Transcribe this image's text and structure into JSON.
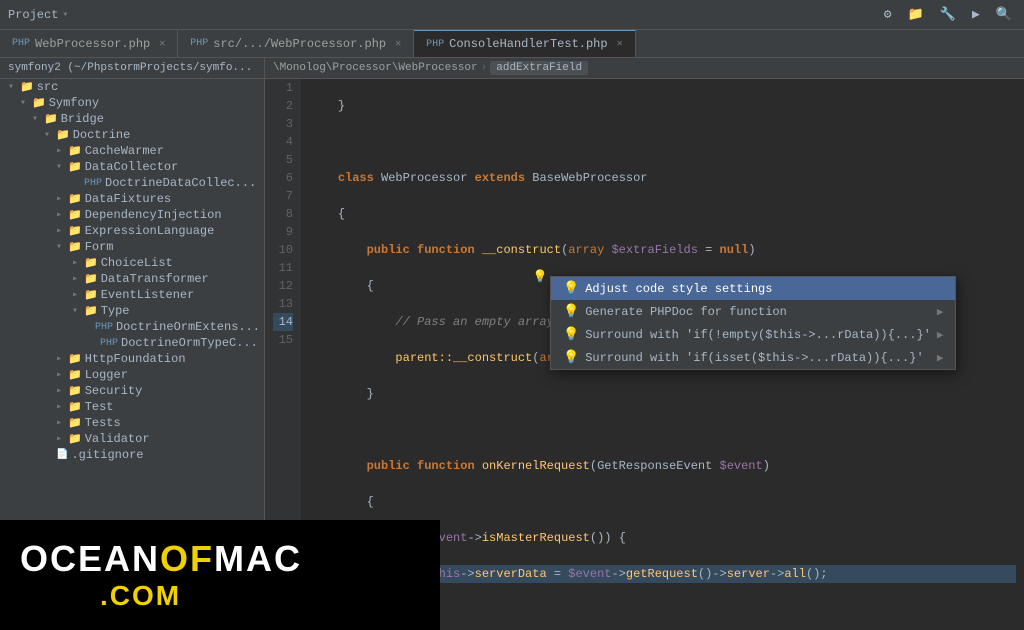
{
  "topbar": {
    "project_label": "Project",
    "icons": [
      "⚙",
      "📁",
      "🔧",
      "▶"
    ]
  },
  "tabs": [
    {
      "label": "WebProcessor.php",
      "active": false,
      "closable": true
    },
    {
      "label": "src/.../WebProcessor.php",
      "active": false,
      "closable": true
    },
    {
      "label": "ConsoleHandlerTest.php",
      "active": true,
      "closable": true
    }
  ],
  "breadcrumb": {
    "path": [
      "\\Monolog\\Processor\\WebProcessor"
    ],
    "active": "addExtraField"
  },
  "sidebar": {
    "header": "symfony2 (~/PhpstormProjects/symfo...",
    "items": [
      {
        "label": "src",
        "type": "folder",
        "level": 0,
        "expanded": true
      },
      {
        "label": "Symfony",
        "type": "folder",
        "level": 1,
        "expanded": true
      },
      {
        "label": "Bridge",
        "type": "folder",
        "level": 2,
        "expanded": true
      },
      {
        "label": "Doctrine",
        "type": "folder",
        "level": 3,
        "expanded": true
      },
      {
        "label": "CacheWarmer",
        "type": "folder",
        "level": 4,
        "expanded": false
      },
      {
        "label": "DataCollector",
        "type": "folder",
        "level": 4,
        "expanded": true
      },
      {
        "label": "DoctrineDataCollec...",
        "type": "file",
        "level": 5
      },
      {
        "label": "DataFixtures",
        "type": "folder",
        "level": 4,
        "expanded": false
      },
      {
        "label": "DependencyInjection",
        "type": "folder",
        "level": 4,
        "expanded": false
      },
      {
        "label": "ExpressionLanguage",
        "type": "folder",
        "level": 4,
        "expanded": false
      },
      {
        "label": "Form",
        "type": "folder",
        "level": 4,
        "expanded": true
      },
      {
        "label": "ChoiceList",
        "type": "folder",
        "level": 5,
        "expanded": false
      },
      {
        "label": "DataTransformer",
        "type": "folder",
        "level": 5,
        "expanded": false
      },
      {
        "label": "EventListener",
        "type": "folder",
        "level": 5,
        "expanded": false
      },
      {
        "label": "Type",
        "type": "folder",
        "level": 5,
        "expanded": true
      },
      {
        "label": "DoctrineOrmExtens...",
        "type": "file",
        "level": 6
      },
      {
        "label": "DoctrineOrmTypeC...",
        "type": "file",
        "level": 6
      },
      {
        "label": "HttpFoundation",
        "type": "folder",
        "level": 4,
        "expanded": false
      },
      {
        "label": "Logger",
        "type": "folder",
        "level": 4,
        "expanded": false
      },
      {
        "label": "Security",
        "type": "folder",
        "level": 4,
        "expanded": false
      },
      {
        "label": "Test",
        "type": "folder",
        "level": 4,
        "expanded": false
      },
      {
        "label": "Tests",
        "type": "folder",
        "level": 4,
        "expanded": false
      },
      {
        "label": "Validator",
        "type": "folder",
        "level": 4,
        "expanded": false
      },
      {
        "label": ".gitignore",
        "type": "file",
        "level": 3
      }
    ]
  },
  "code": {
    "lines": [
      {
        "num": 1,
        "text": "    }"
      },
      {
        "num": 2,
        "text": ""
      },
      {
        "num": 3,
        "text": "    class WebProcessor extends BaseWebProcessor"
      },
      {
        "num": 4,
        "text": "    {"
      },
      {
        "num": 5,
        "text": "        public function __construct(array $extraFields = null)"
      },
      {
        "num": 6,
        "text": "        {"
      },
      {
        "num": 7,
        "text": "            // Pass an empty array as the default null value would access $_SERVER"
      },
      {
        "num": 8,
        "text": "            parent::__construct(array(), $extraFields);"
      },
      {
        "num": 9,
        "text": "        }"
      },
      {
        "num": 10,
        "text": ""
      },
      {
        "num": 11,
        "text": "        public function onKernelRequest(GetResponseEvent $event)"
      },
      {
        "num": 12,
        "text": "        {"
      },
      {
        "num": 13,
        "text": "            if ($event->isMasterRequest()) {"
      },
      {
        "num": 14,
        "text": "                $this->serverData = $event->getRequest()->server->all();"
      },
      {
        "num": 15,
        "text": ""
      }
    ]
  },
  "context_menu": {
    "items": [
      {
        "label": "Adjust code style settings",
        "icon": "💡",
        "selected": true,
        "has_arrow": false
      },
      {
        "label": "Generate PHPDoc for function",
        "icon": "💡",
        "selected": false,
        "has_arrow": true
      },
      {
        "label": "Surround with 'if(!empty($this->...rData)){...}'",
        "icon": "💡",
        "selected": false,
        "has_arrow": true
      },
      {
        "label": "Surround with 'if(isset($this->...rData)){...}'",
        "icon": "💡",
        "selected": false,
        "has_arrow": true
      }
    ]
  },
  "watermark": {
    "line1_part1": "OCEAN",
    "line1_of": "OF",
    "line1_part2": "MAC",
    "line2": ".COM"
  }
}
